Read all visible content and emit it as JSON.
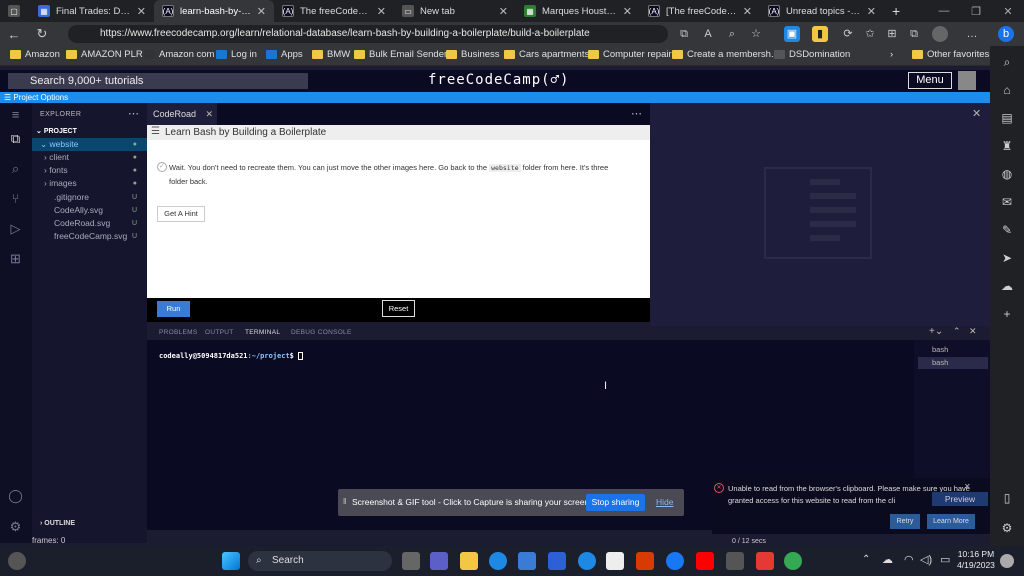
{
  "browser": {
    "tabs": [
      {
        "title": "Final Trades: DAL, KRE",
        "icon": "finaltrades-icon",
        "color": "#3b6bd6"
      },
      {
        "title": "learn-bash-by-buildin",
        "icon": "freecodecamp-icon",
        "color": "#0a0a23"
      },
      {
        "title": "The freeCodeCamp Fo",
        "icon": "freecodecamp-icon",
        "color": "#0a0a23"
      },
      {
        "title": "New tab",
        "icon": "newtab-icon",
        "color": "#555"
      },
      {
        "title": "Marques Houston Say",
        "icon": "news-icon",
        "color": "#2e7d32"
      },
      {
        "title": "[The freeCodeCamp F",
        "icon": "freecodecamp-icon",
        "color": "#0a0a23"
      },
      {
        "title": "Unread topics - The fr",
        "icon": "freecodecamp-icon",
        "color": "#0a0a23"
      }
    ],
    "url": "https://www.freecodecamp.org/learn/relational-database/learn-bash-by-building-a-boilerplate/build-a-boilerplate",
    "bookmarks": [
      "Amazon",
      "AMAZON PLR",
      "Amazon com",
      "Log in",
      "Apps",
      "BMW",
      "Bulk Email Sender",
      "Business",
      "Cars apartments",
      "Computer repair",
      "Create a membersh...",
      "DSDomination"
    ],
    "other_favorites": "Other favorites"
  },
  "fcc": {
    "search_placeholder": "Search 9,000+ tutorials",
    "logo": "freeCodeCamp(♂)",
    "menu": "Menu",
    "project_options": "Project Options"
  },
  "explorer": {
    "header": "EXPLORER",
    "project": "PROJECT",
    "items": [
      {
        "name": "website",
        "status": "●"
      },
      {
        "name": "client",
        "status": "●"
      },
      {
        "name": "fonts",
        "status": "●"
      },
      {
        "name": "images",
        "status": "●"
      },
      {
        "name": ".gitignore",
        "status": "U"
      },
      {
        "name": "CodeAlly.svg",
        "status": "U"
      },
      {
        "name": "CodeRoad.svg",
        "status": "U"
      },
      {
        "name": "freeCodeCamp.svg",
        "status": "U"
      }
    ],
    "outline": "OUTLINE"
  },
  "editor": {
    "tab": "CodeRoad",
    "lesson_title": "Learn Bash by Building a Boilerplate",
    "step_text_1": "Wait. You don't need to recreate them. You can just move the other images here. Go back to the",
    "step_code": "website",
    "step_text_2": "folder from here. It's three folder back.",
    "hint_button": "Get A Hint",
    "run_button": "Run",
    "reset_button": "Reset"
  },
  "panel": {
    "tabs": [
      "PROBLEMS",
      "OUTPUT",
      "TERMINAL",
      "DEBUG CONSOLE"
    ],
    "prompt_user": "codeally@5094817da521",
    "prompt_path": ":~/project",
    "prompt_end": "$",
    "terminals": [
      "bash",
      "bash"
    ]
  },
  "share": {
    "message": "Screenshot & GIF tool - Click to Capture is sharing your screen.",
    "stop": "Stop sharing",
    "hide": "Hide"
  },
  "clipboard": {
    "message": "Unable to read from the browser's clipboard. Please make sure you have granted access for this website to read from the cli",
    "retry": "Retry",
    "learn_more": "Learn More",
    "preview": "Preview"
  },
  "footer": {
    "frames": "frames: 0",
    "timer": "0 / 12 secs"
  },
  "taskbar": {
    "search": "Search",
    "time": "10:16 PM",
    "date": "4/19/2023"
  }
}
